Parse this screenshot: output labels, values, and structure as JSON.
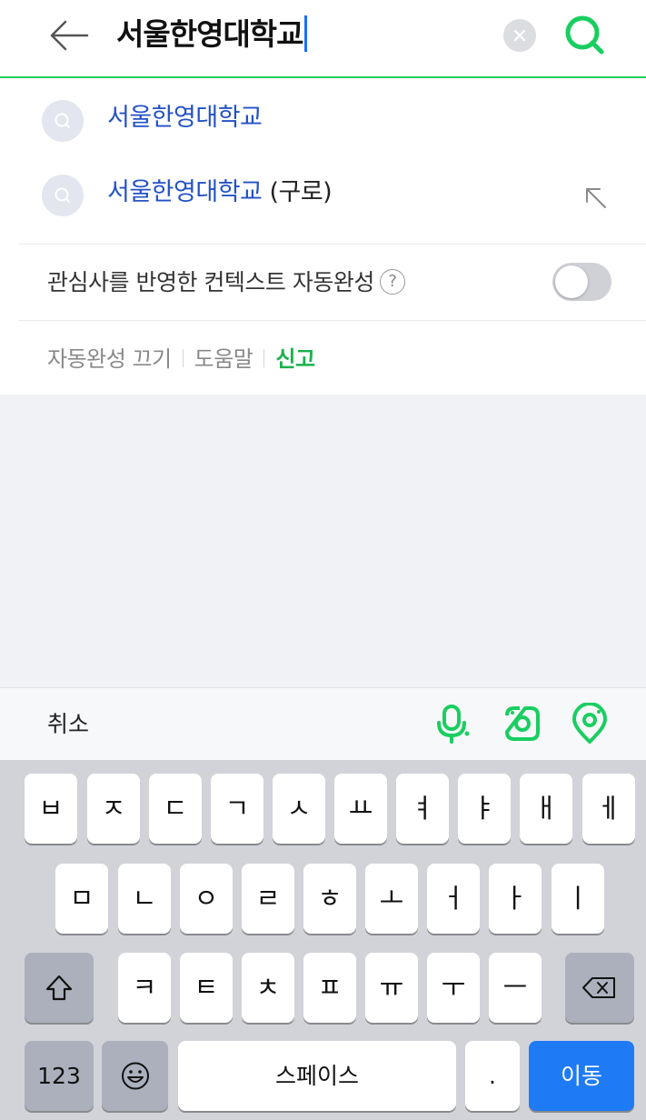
{
  "search": {
    "query": "서울한영대학교"
  },
  "suggestions": [
    {
      "text": "서울한영대학교",
      "extra": ""
    },
    {
      "text": "서울한영대학교",
      "extra": " (구로)"
    }
  ],
  "context": {
    "label": "관심사를 반영한 컨텍스트 자동완성",
    "help": "?",
    "toggle_state": "off"
  },
  "links": {
    "autocomplete_off": "자동완성 끄기",
    "help": "도움말",
    "report": "신고"
  },
  "accessory": {
    "cancel": "취소",
    "icons": [
      "microphone-icon",
      "camera-lens-icon",
      "location-pin-icon"
    ]
  },
  "keyboard": {
    "row1": [
      "ㅂ",
      "ㅈ",
      "ㄷ",
      "ㄱ",
      "ㅅ",
      "ㅛ",
      "ㅕ",
      "ㅑ",
      "ㅐ",
      "ㅔ"
    ],
    "row2": [
      "ㅁ",
      "ㄴ",
      "ㅇ",
      "ㄹ",
      "ㅎ",
      "ㅗ",
      "ㅓ",
      "ㅏ",
      "ㅣ"
    ],
    "row3": [
      "ㅋ",
      "ㅌ",
      "ㅊ",
      "ㅍ",
      "ㅠ",
      "ㅜ",
      "ㅡ"
    ],
    "numbers": "123",
    "space": "스페이스",
    "period": ".",
    "go": "이동"
  },
  "colors": {
    "accent_green": "#19ce60",
    "link_blue": "#2352c6",
    "go_blue": "#1f7bf5"
  }
}
